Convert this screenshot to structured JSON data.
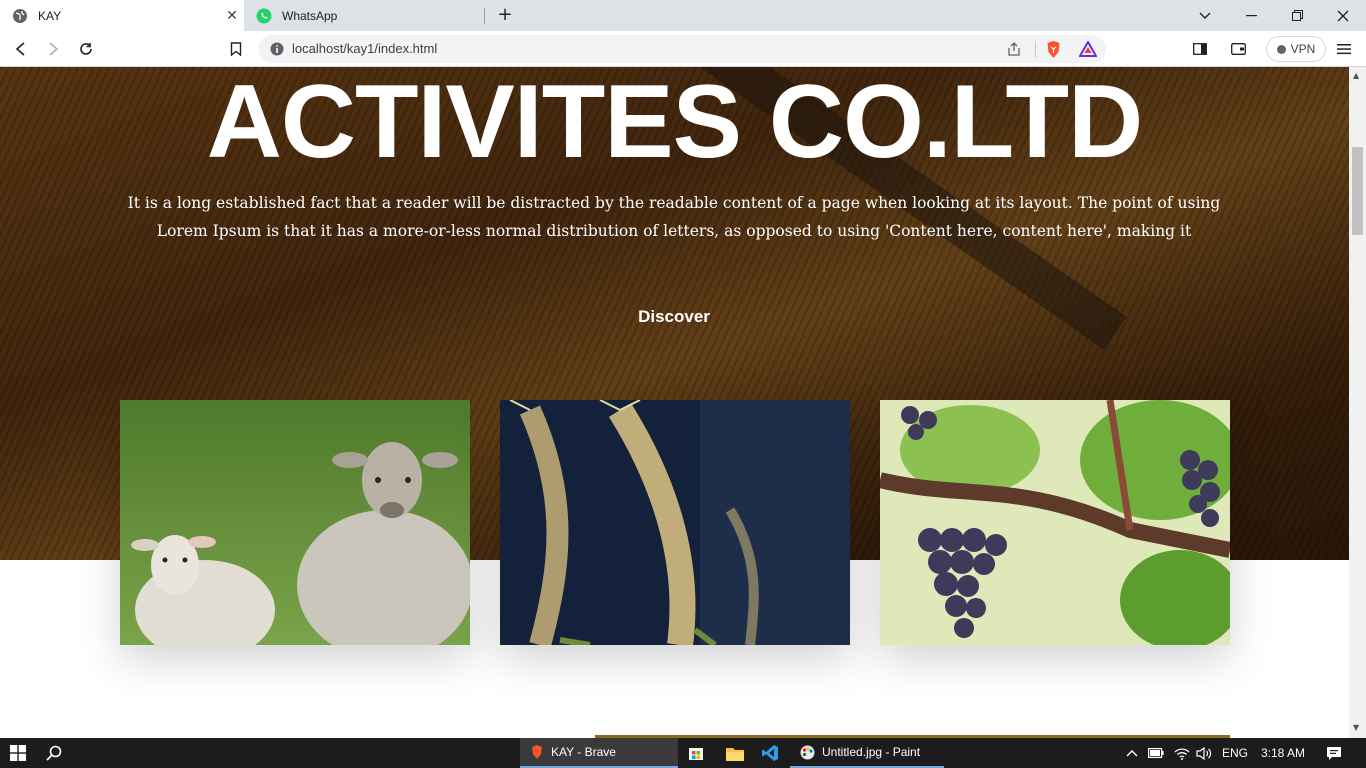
{
  "browser": {
    "tabs": [
      {
        "title": "KAY",
        "active": true
      },
      {
        "title": "WhatsApp",
        "active": false
      }
    ],
    "url": "localhost/kay1/index.html",
    "vpn_label": "VPN"
  },
  "hero": {
    "title": "ACTIVITES CO.LTD",
    "text": "It is a long established fact that a reader will be distracted by the readable content of a page when looking at its layout. The point of using Lorem Ipsum is that it has a more-or-less normal distribution of letters, as opposed to using 'Content here, content here', making it",
    "cta": "Discover"
  },
  "cards": [
    {
      "icon": "sheep-photo"
    },
    {
      "icon": "wheat-photo"
    },
    {
      "icon": "grapes-photo"
    }
  ],
  "taskbar": {
    "apps": [
      {
        "label": "KAY - Brave"
      },
      {
        "label": "Untitled.jpg - Paint"
      }
    ],
    "language": "ENG",
    "time": "3:18 AM"
  },
  "colors": {
    "tab_strip": "#dee1e6",
    "taskbar": "#1c1c1c",
    "hero_overlay": "#5a3413",
    "brave_orange": "#fb542b"
  }
}
